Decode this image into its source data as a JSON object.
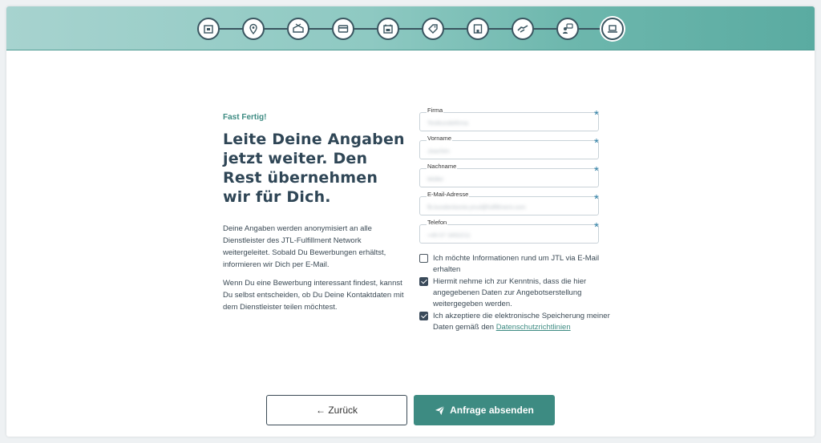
{
  "stepper": {
    "steps": [
      {
        "icon": "storage-box-icon"
      },
      {
        "icon": "location-pin-icon"
      },
      {
        "icon": "package-icon"
      },
      {
        "icon": "payment-card-icon"
      },
      {
        "icon": "calendar-icon"
      },
      {
        "icon": "tag-icon"
      },
      {
        "icon": "building-icon"
      },
      {
        "icon": "handshake-icon"
      },
      {
        "icon": "person-chat-icon"
      },
      {
        "icon": "laptop-icon"
      }
    ],
    "active_color": "#3d8b82"
  },
  "intro": {
    "eyebrow": "Fast Fertig!",
    "headline": "Leite Deine Angaben jetzt weiter. Den Rest übernehmen wir für Dich.",
    "paragraph1": "Deine Angaben werden anonymisiert an alle Dienstleister des JTL-Fulfillment Network weitergeleitet. Sobald Du Bewerbungen erhältst, informieren wir Dich per E-Mail.",
    "paragraph2": "Wenn Du eine Bewerbung interessant findest, kannst Du selbst entscheiden, ob Du Deine Kontaktdaten mit dem Dienstleister teilen möchtest."
  },
  "form": {
    "required_mark": "*",
    "fields": [
      {
        "label": "Firma",
        "value": "Testkundefirma"
      },
      {
        "label": "Vorname",
        "value": "Joachim"
      },
      {
        "label": "Nachname",
        "value": "Müller"
      },
      {
        "label": "E-Mail-Adresse",
        "value": "fb.kundenkonto.jmul@fulfillment.com"
      },
      {
        "label": "Telefon",
        "value": "+49 07 3452211"
      }
    ],
    "checkboxes": [
      {
        "text": "Ich möchte Informationen rund um JTL via E-Mail erhalten",
        "checked": false
      },
      {
        "text": "Hiermit nehme ich zur Kenntnis, dass die hier angegebenen Daten zur Angebotserstellung weitergegeben werden.",
        "checked": true
      },
      {
        "text": "Ich akzeptiere die elektronische Speicherung meiner Daten gemäß den",
        "link": "Datenschutzrichtlinien",
        "checked": true
      }
    ]
  },
  "buttons": {
    "back_label": "← Zurück",
    "submit_label": "Anfrage absenden"
  }
}
